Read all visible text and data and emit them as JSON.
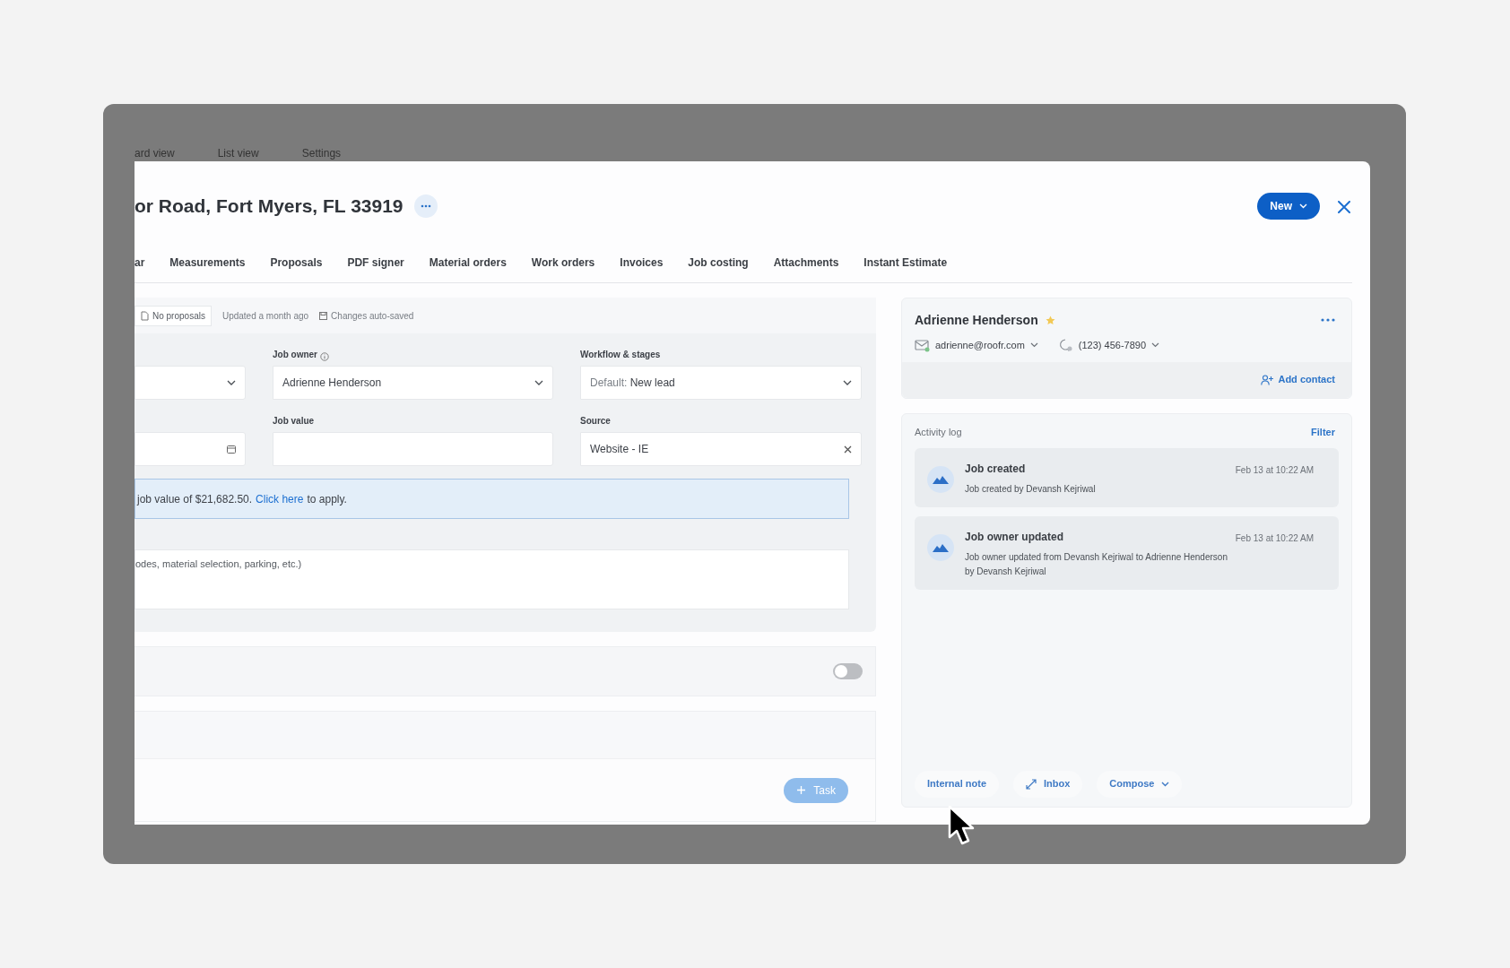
{
  "background_tabs": [
    "ard view",
    "List view",
    "Settings"
  ],
  "title": "or Road, Fort Myers, FL 33919",
  "new_button": "New",
  "tabs": [
    {
      "label": "ar",
      "selected": false
    },
    {
      "label": "Measurements",
      "selected": false
    },
    {
      "label": "Proposals",
      "selected": false
    },
    {
      "label": "PDF signer",
      "selected": false
    },
    {
      "label": "Material orders",
      "selected": false
    },
    {
      "label": "Work orders",
      "selected": false
    },
    {
      "label": "Invoices",
      "selected": false
    },
    {
      "label": "Job costing",
      "selected": false
    },
    {
      "label": "Attachments",
      "selected": false
    },
    {
      "label": "Instant Estimate",
      "selected": false
    }
  ],
  "meta": {
    "proposals": "No proposals",
    "updated": "Updated a month ago",
    "autosave": "Changes auto-saved"
  },
  "fields": [
    {
      "kind": "select"
    },
    {
      "kind": "select",
      "label": "Job owner",
      "info": true,
      "value": "Adrienne Henderson"
    },
    {
      "kind": "select",
      "label": "Workflow & stages",
      "prefix": "Default:",
      "value": "New lead"
    },
    {
      "kind": "date"
    },
    {
      "kind": "text",
      "label": "Job value"
    },
    {
      "kind": "clearable",
      "label": "Source",
      "value": "Website - IE"
    }
  ],
  "notice": {
    "before": "job value of $21,682.50.",
    "link": "Click here",
    "after": "to apply."
  },
  "notes": {
    "placeholder": "odes, material selection, parking, etc.)"
  },
  "toggle": {
    "on": false
  },
  "task_button": "Task",
  "contact": {
    "name": "Adrienne Henderson",
    "starred": true,
    "email": "adrienne@roofr.com",
    "phone": "(123) 456-7890",
    "add_contact": "Add contact"
  },
  "activity": {
    "title": "Activity log",
    "filter": "Filter",
    "entries": [
      {
        "title": "Job created",
        "time": "Feb 13 at 10:22 AM",
        "text": "Job created by Devansh Kejriwal"
      },
      {
        "title": "Job owner updated",
        "time": "Feb 13 at 10:22 AM",
        "text": "Job owner updated from Devansh Kejriwal to Adrienne Henderson by Devansh Kejriwal"
      }
    ],
    "actions": [
      {
        "kind": "plain",
        "label": "Internal note"
      },
      {
        "kind": "expand",
        "label": "Inbox"
      },
      {
        "kind": "dropdown",
        "label": "Compose"
      }
    ]
  }
}
